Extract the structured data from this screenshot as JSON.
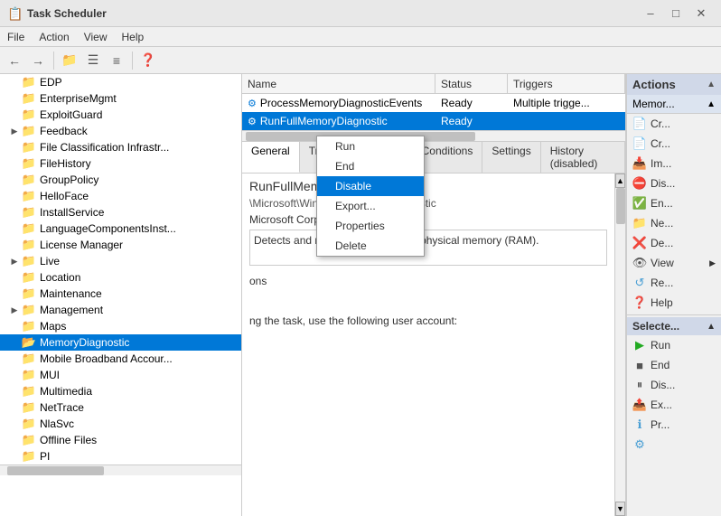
{
  "window": {
    "title": "Task Scheduler",
    "icon": "scheduler-icon"
  },
  "menubar": {
    "items": [
      "File",
      "Action",
      "View",
      "Help"
    ]
  },
  "toolbar": {
    "buttons": [
      "back",
      "forward",
      "up",
      "show-hide-console-tree",
      "show-hide-action-pane",
      "help"
    ]
  },
  "left_panel": {
    "tree_items": [
      {
        "label": "EDP",
        "indent": 1,
        "has_expand": false
      },
      {
        "label": "EnterpriseMgmt",
        "indent": 1,
        "has_expand": false
      },
      {
        "label": "ExploitGuard",
        "indent": 1,
        "has_expand": false
      },
      {
        "label": "Feedback",
        "indent": 1,
        "has_expand": true,
        "expanded": false
      },
      {
        "label": "File Classification Infrastr...",
        "indent": 1,
        "has_expand": false
      },
      {
        "label": "FileHistory",
        "indent": 1,
        "has_expand": false
      },
      {
        "label": "GroupPolicy",
        "indent": 1,
        "has_expand": false
      },
      {
        "label": "HelloFace",
        "indent": 1,
        "has_expand": false
      },
      {
        "label": "InstallService",
        "indent": 1,
        "has_expand": false
      },
      {
        "label": "LanguageComponentsInst...",
        "indent": 1,
        "has_expand": false
      },
      {
        "label": "License Manager",
        "indent": 1,
        "has_expand": false
      },
      {
        "label": "Live",
        "indent": 1,
        "has_expand": true,
        "expanded": false
      },
      {
        "label": "Location",
        "indent": 1,
        "has_expand": false
      },
      {
        "label": "Maintenance",
        "indent": 1,
        "has_expand": false
      },
      {
        "label": "Management",
        "indent": 1,
        "has_expand": true,
        "expanded": false
      },
      {
        "label": "Maps",
        "indent": 1,
        "has_expand": false
      },
      {
        "label": "MemoryDiagnostic",
        "indent": 1,
        "has_expand": false,
        "selected": true
      },
      {
        "label": "Mobile Broadband Accour...",
        "indent": 1,
        "has_expand": false
      },
      {
        "label": "MUI",
        "indent": 1,
        "has_expand": false
      },
      {
        "label": "Multimedia",
        "indent": 1,
        "has_expand": false
      },
      {
        "label": "NetTrace",
        "indent": 1,
        "has_expand": false
      },
      {
        "label": "NlaSvc",
        "indent": 1,
        "has_expand": false
      },
      {
        "label": "Offline Files",
        "indent": 1,
        "has_expand": false
      },
      {
        "label": "PI",
        "indent": 1,
        "has_expand": false
      }
    ]
  },
  "task_list": {
    "columns": [
      "Name",
      "Status",
      "Triggers"
    ],
    "rows": [
      {
        "name": "ProcessMemoryDiagnosticEvents",
        "status": "Ready",
        "triggers": "Multiple trigge..."
      },
      {
        "name": "RunFullMemoryDiagnostic",
        "status": "Ready",
        "triggers": "",
        "selected": true
      }
    ]
  },
  "context_menu": {
    "items": [
      {
        "label": "Run",
        "selected": false
      },
      {
        "label": "End",
        "selected": false
      },
      {
        "label": "Disable",
        "selected": true
      },
      {
        "label": "Export...",
        "selected": false
      },
      {
        "label": "Properties",
        "selected": false
      },
      {
        "label": "Delete",
        "selected": false
      }
    ]
  },
  "tabs": {
    "items": [
      "General",
      "Triggers",
      "Actions",
      "Conditions",
      "Settings",
      "History (disabled)"
    ],
    "active": "General"
  },
  "detail": {
    "task_name": "RunFullMemoryDiagnostic",
    "task_path": "\\Microsoft\\Windows\\MemoryDiagnostic",
    "task_author": "Microsoft Corporation",
    "task_description": "Detects and mitigates problems in physical memory (RAM).",
    "extra_text_1": "ons",
    "extra_text_2": "ng the task, use the following user account:"
  },
  "right_panel": {
    "actions_title": "Actions",
    "memory_label": "Memor...",
    "action_items": [
      {
        "label": "Cr...",
        "icon": "create-icon",
        "color": "#4a9fd4"
      },
      {
        "label": "Cr...",
        "icon": "create-icon2",
        "color": "#4a9fd4"
      },
      {
        "label": "Im...",
        "icon": "import-icon",
        "color": "#4a9fd4"
      },
      {
        "label": "Dis...",
        "icon": "disable-icon",
        "color": "#4a9fd4"
      },
      {
        "label": "En...",
        "icon": "enable-icon",
        "color": "#4a9fd4"
      },
      {
        "label": "Ne...",
        "icon": "new-icon",
        "color": "#4a9fd4"
      },
      {
        "label": "De...",
        "icon": "delete-icon",
        "color": "#e00"
      },
      {
        "label": "View",
        "icon": "view-icon",
        "color": "#555",
        "has_sub": true
      },
      {
        "label": "Re...",
        "icon": "refresh-icon",
        "color": "#4a9fd4"
      },
      {
        "label": "Help",
        "icon": "help-icon",
        "color": "#4a9fd4"
      }
    ],
    "selected_title": "Selecte...",
    "selected_items": [
      {
        "label": "Run",
        "icon": "run-icon",
        "color": "#22aa22"
      },
      {
        "label": "End",
        "icon": "end-icon",
        "color": "#555"
      },
      {
        "label": "Dis...",
        "icon": "dis-icon",
        "color": "#555"
      },
      {
        "label": "Ex...",
        "icon": "ex-icon",
        "color": "#4a9fd4"
      },
      {
        "label": "Pr...",
        "icon": "pr-icon",
        "color": "#4a9fd4"
      }
    ]
  }
}
